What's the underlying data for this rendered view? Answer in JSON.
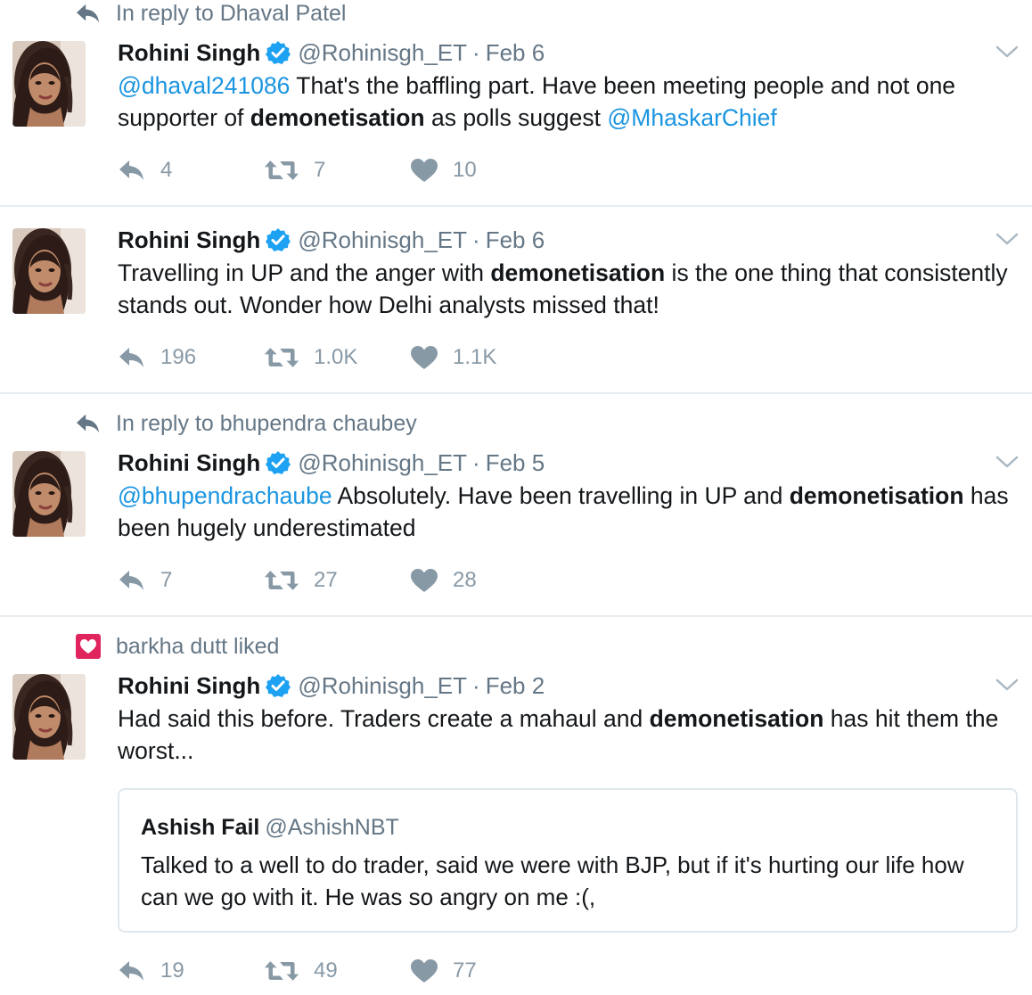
{
  "colors": {
    "link": "#1b95e0",
    "muted": "#657786",
    "action_gray": "#8899a6",
    "verified_blue": "#1da1f2",
    "like_badge": "#e0245e",
    "divider": "#e6ecf0"
  },
  "tweets": [
    {
      "context": {
        "icon": "reply-arrow-icon",
        "text": "In reply to Dhaval Patel"
      },
      "author": {
        "name": "Rohini Singh",
        "handle": "@Rohinisgh_ET",
        "separator": "·",
        "date": "Feb 6"
      },
      "text": {
        "mention": "@dhaval241086",
        "part1": " That's the baffling part. Have been meeting people and not one supporter of ",
        "bold": "demonetisation",
        "part2": " as polls suggest ",
        "mention2": "@MhaskarChief"
      },
      "counts": {
        "replies": "4",
        "retweets": "7",
        "likes": "10"
      }
    },
    {
      "author": {
        "name": "Rohini Singh",
        "handle": "@Rohinisgh_ET",
        "separator": "·",
        "date": "Feb 6"
      },
      "text": {
        "part1": "Travelling in UP and the anger with ",
        "bold": "demonetisation",
        "part2": " is the one thing that consistently stands out. Wonder how Delhi analysts missed that!"
      },
      "counts": {
        "replies": "196",
        "retweets": "1.0K",
        "likes": "1.1K"
      }
    },
    {
      "context": {
        "icon": "reply-arrow-icon",
        "text": "In reply to bhupendra chaubey"
      },
      "author": {
        "name": "Rohini Singh",
        "handle": "@Rohinisgh_ET",
        "separator": "·",
        "date": "Feb 5"
      },
      "text": {
        "mention": "@bhupendrachaube",
        "part1": " Absolutely. Have been travelling in UP and ",
        "bold": "demonetisation",
        "part2": " has been hugely underestimated"
      },
      "counts": {
        "replies": "7",
        "retweets": "27",
        "likes": "28"
      }
    },
    {
      "context": {
        "icon": "liked-heart-icon",
        "text": "barkha dutt liked"
      },
      "author": {
        "name": "Rohini Singh",
        "handle": "@Rohinisgh_ET",
        "separator": "·",
        "date": "Feb 2"
      },
      "text": {
        "part1": "Had said this before. Traders create a mahaul and ",
        "bold": "demonetisation",
        "part2": " has hit them the worst..."
      },
      "quote": {
        "name": "Ashish Fail",
        "handle": "@AshishNBT",
        "text": "Talked to a well to do trader,  said we were with BJP,  but if it's hurting our life how can we go with it.  He was so angry on me :(,"
      },
      "counts": {
        "replies": "19",
        "retweets": "49",
        "likes": "77"
      }
    }
  ]
}
